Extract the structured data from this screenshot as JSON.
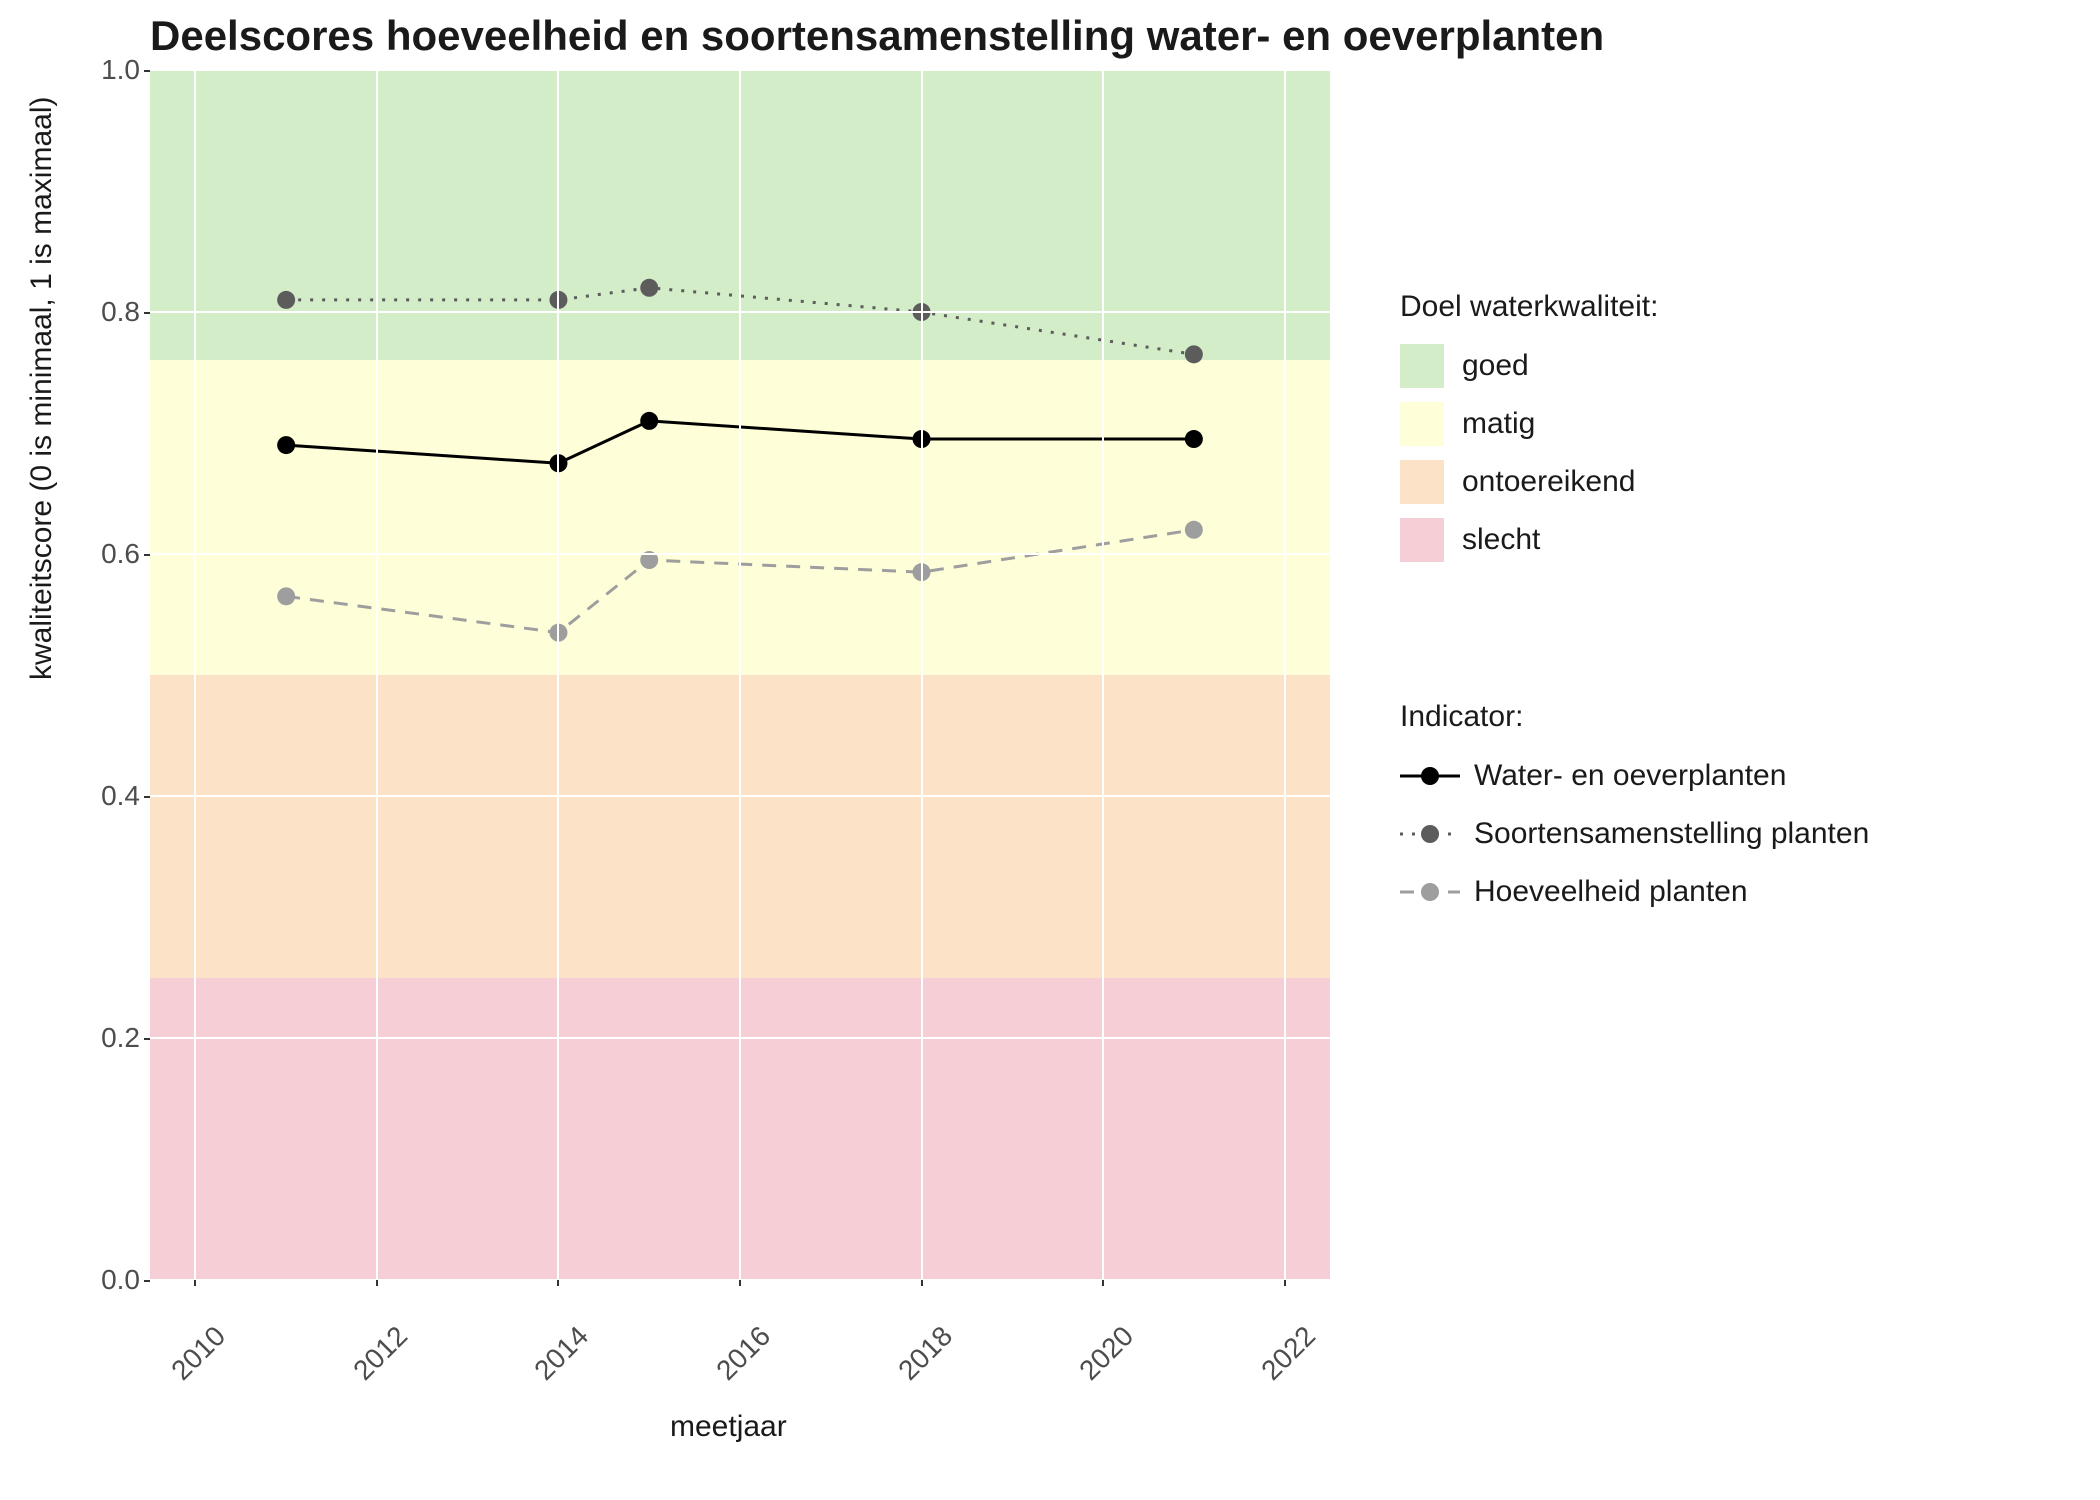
{
  "chart_data": {
    "type": "line",
    "title": "Deelscores hoeveelheid en soortensamenstelling water- en oeverplanten",
    "xlabel": "meetjaar",
    "ylabel": "kwaliteitscore (0 is minimaal, 1 is maximaal)",
    "x_ticks": [
      2010,
      2012,
      2014,
      2016,
      2018,
      2020,
      2022
    ],
    "y_ticks": [
      0.0,
      0.2,
      0.4,
      0.6,
      0.8,
      1.0
    ],
    "ylim": [
      0.0,
      1.0
    ],
    "xlim": [
      2009.5,
      2022.5
    ],
    "bands": [
      {
        "name": "goed",
        "from": 0.76,
        "to": 1.0,
        "color": "#d4edc9"
      },
      {
        "name": "matig",
        "from": 0.5,
        "to": 0.76,
        "color": "#fefed9"
      },
      {
        "name": "ontoereikend",
        "from": 0.25,
        "to": 0.5,
        "color": "#fce3c8"
      },
      {
        "name": "slecht",
        "from": 0.0,
        "to": 0.25,
        "color": "#f6ced5"
      }
    ],
    "series": [
      {
        "name": "Water- en oeverplanten",
        "color": "#000000",
        "dash": "solid",
        "x": [
          2011,
          2014,
          2015,
          2018,
          2021
        ],
        "y": [
          0.69,
          0.675,
          0.71,
          0.695,
          0.695
        ]
      },
      {
        "name": "Soortensamenstelling planten",
        "color": "#5c5c5c",
        "dash": "dotted",
        "x": [
          2011,
          2014,
          2015,
          2018,
          2021
        ],
        "y": [
          0.81,
          0.81,
          0.82,
          0.8,
          0.765
        ]
      },
      {
        "name": "Hoeveelheid planten",
        "color": "#9e9e9e",
        "dash": "dashed",
        "x": [
          2011,
          2014,
          2015,
          2018,
          2021
        ],
        "y": [
          0.565,
          0.535,
          0.595,
          0.585,
          0.62
        ]
      }
    ],
    "legends": {
      "quality": {
        "title": "Doel waterkwaliteit:",
        "items": [
          "goed",
          "matig",
          "ontoereikend",
          "slecht"
        ]
      },
      "indicator": {
        "title": "Indicator:",
        "items": [
          "Water- en oeverplanten",
          "Soortensamenstelling planten",
          "Hoeveelheid planten"
        ]
      }
    }
  }
}
